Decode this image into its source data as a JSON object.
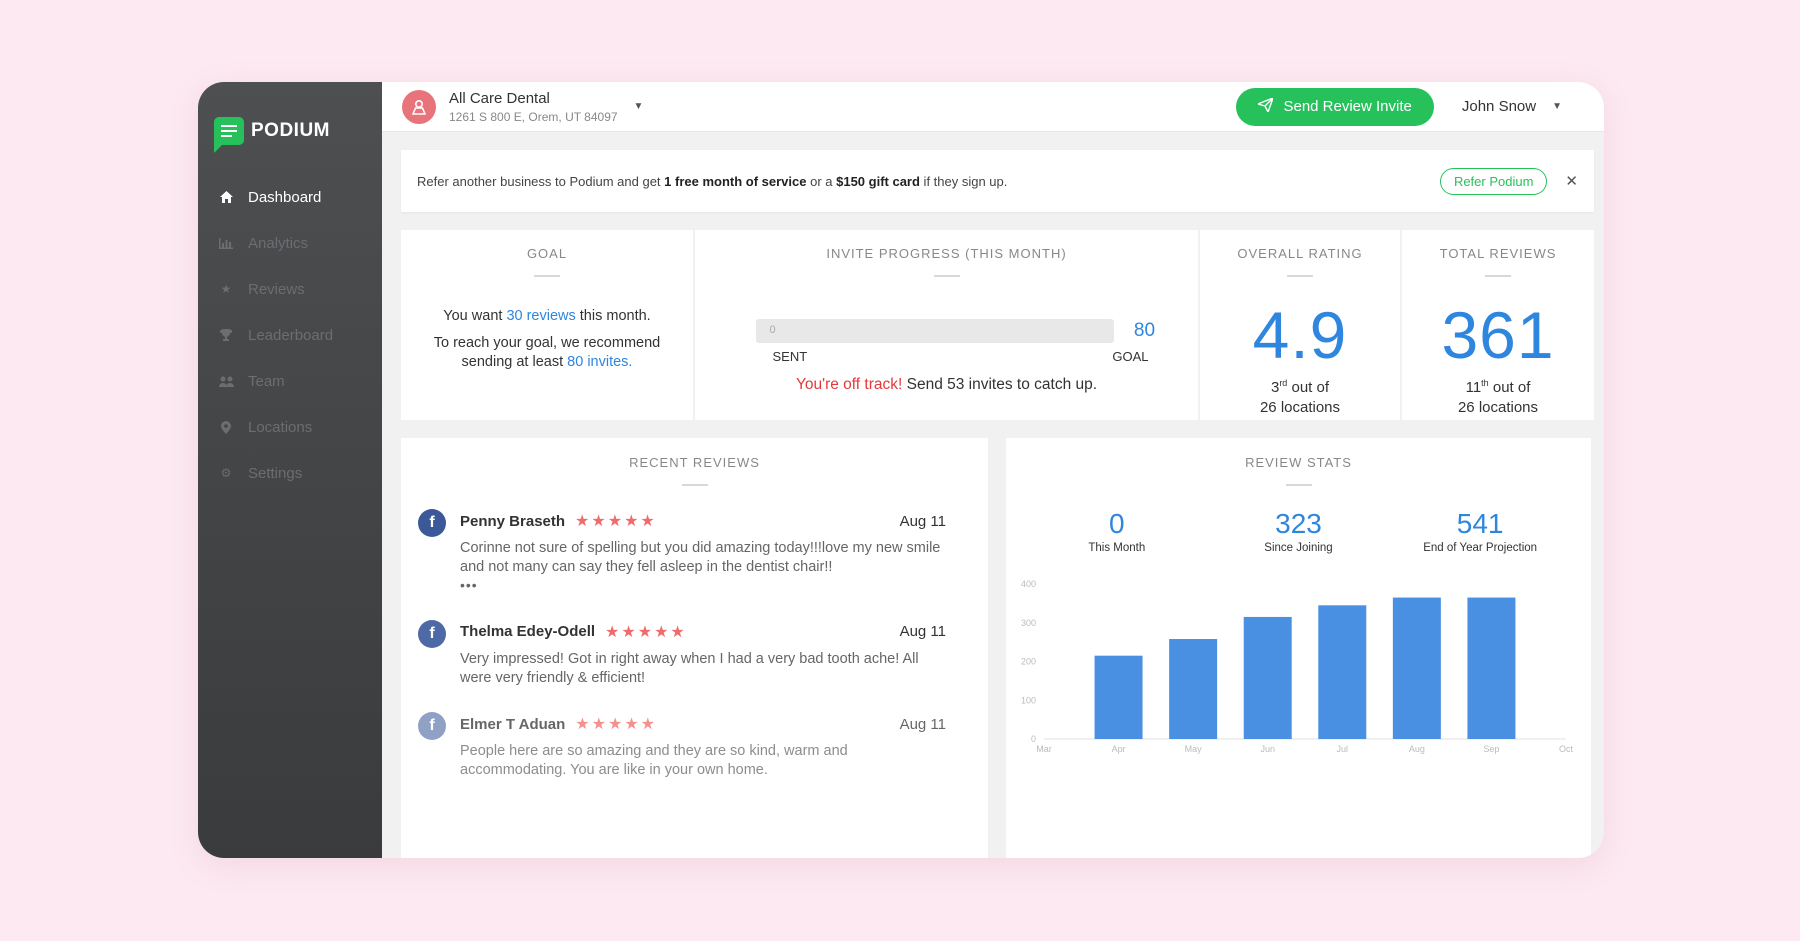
{
  "brand": "PODIUM",
  "nav": [
    {
      "label": "Dashboard",
      "icon": "home-icon",
      "active": true
    },
    {
      "label": "Analytics",
      "icon": "bar-chart-icon"
    },
    {
      "label": "Reviews",
      "icon": "star-icon"
    },
    {
      "label": "Leaderboard",
      "icon": "trophy-icon"
    },
    {
      "label": "Team",
      "icon": "team-icon"
    },
    {
      "label": "Locations",
      "icon": "location-pin-icon"
    },
    {
      "label": "Settings",
      "icon": "gear-icon"
    }
  ],
  "location": {
    "name": "All Care Dental",
    "address": "1261 S 800 E, Orem, UT 84097"
  },
  "header": {
    "send_label": "Send Review Invite",
    "user": "John Snow"
  },
  "banner": {
    "p1": "Refer another business to Podium and get ",
    "b1": "1 free month of service",
    "p2": " or a ",
    "b2": "$150 gift card",
    "p3": " if they sign up.",
    "button": "Refer Podium"
  },
  "goal": {
    "title": "GOAL",
    "l1a": "You want ",
    "l1b": "30 reviews",
    "l1c": " this month.",
    "l2a": "To reach your goal, we recommend",
    "l2b": "sending at least ",
    "l2c": "80 invites."
  },
  "invite": {
    "title": "INVITE PROGRESS (THIS MONTH)",
    "sent": "0",
    "goal_value": "80",
    "progress_fraction": 0.0,
    "sent_label": "SENT",
    "goal_label": "GOAL",
    "warn": "You're off track!",
    "msg": " Send 53 invites to catch up."
  },
  "rating": {
    "title": "OVERALL RATING",
    "value": "4.9",
    "rank_num": "3",
    "rank_sup": "rd",
    "rank_rest": " out of",
    "rank_line2": "26 locations"
  },
  "total": {
    "title": "TOTAL REVIEWS",
    "value": "361",
    "rank_num": "11",
    "rank_sup": "th",
    "rank_rest": " out of",
    "rank_line2": "26 locations"
  },
  "recent": {
    "title": "RECENT REVIEWS",
    "items": [
      {
        "name": "Penny Braseth",
        "date": "Aug 11",
        "stars": 5,
        "text": "Corinne not sure of spelling but you did amazing today!!!love my new smile and not many can say they fell asleep in the dentist chair!!",
        "more": "•••"
      },
      {
        "name": "Thelma Edey-Odell",
        "date": "Aug 11",
        "stars": 5,
        "text": "Very impressed! Got in right away when I had a very bad tooth ache! All were very friendly & efficient!"
      },
      {
        "name": "Elmer T Aduan",
        "date": "Aug 11",
        "stars": 5,
        "text": "People here are so amazing and they are so kind, warm and accommodating. You are like in your own home."
      }
    ]
  },
  "stats": {
    "title": "REVIEW STATS",
    "summary": [
      {
        "value": "0",
        "label": "This Month"
      },
      {
        "value": "323",
        "label": "Since Joining"
      },
      {
        "value": "541",
        "label": "End of Year Projection"
      }
    ]
  },
  "chart_data": {
    "type": "bar",
    "categories": [
      "Apr",
      "May",
      "Jun",
      "Jul",
      "Aug",
      "Sep"
    ],
    "x_ticks": [
      "Mar",
      "Apr",
      "May",
      "Jun",
      "Jul",
      "Aug",
      "Sep",
      "Oct"
    ],
    "values": [
      215,
      258,
      315,
      345,
      365,
      365
    ],
    "y_ticks": [
      0,
      100,
      200,
      300,
      400
    ],
    "ylim": [
      0,
      400
    ],
    "grid": false,
    "bar_color": "#4a90e2"
  }
}
